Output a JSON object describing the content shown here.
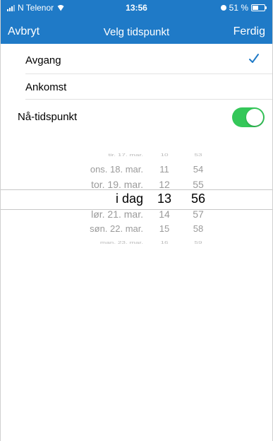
{
  "status_bar": {
    "carrier": "N Telenor",
    "time": "13:56",
    "battery": "51 %"
  },
  "nav": {
    "cancel": "Avbryt",
    "title": "Velg tidspunkt",
    "done": "Ferdig"
  },
  "options": [
    {
      "label": "Avgang",
      "selected": true
    },
    {
      "label": "Ankomst",
      "selected": false
    }
  ],
  "now_toggle": {
    "label": "Nå-tidspunkt",
    "on": true
  },
  "picker": {
    "days": [
      "tir. 17. mar.",
      "ons. 18. mar.",
      "tor. 19. mar.",
      "i dag",
      "lør. 21. mar.",
      "søn. 22. mar.",
      "man. 23. mar."
    ],
    "hours": [
      "10",
      "11",
      "12",
      "13",
      "14",
      "15",
      "16"
    ],
    "minutes": [
      "53",
      "54",
      "55",
      "56",
      "57",
      "58",
      "59"
    ],
    "selected_index": 3
  },
  "colors": {
    "header": "#1f7ac7",
    "accent": "#1f7ac7",
    "toggle_on": "#34c759"
  }
}
